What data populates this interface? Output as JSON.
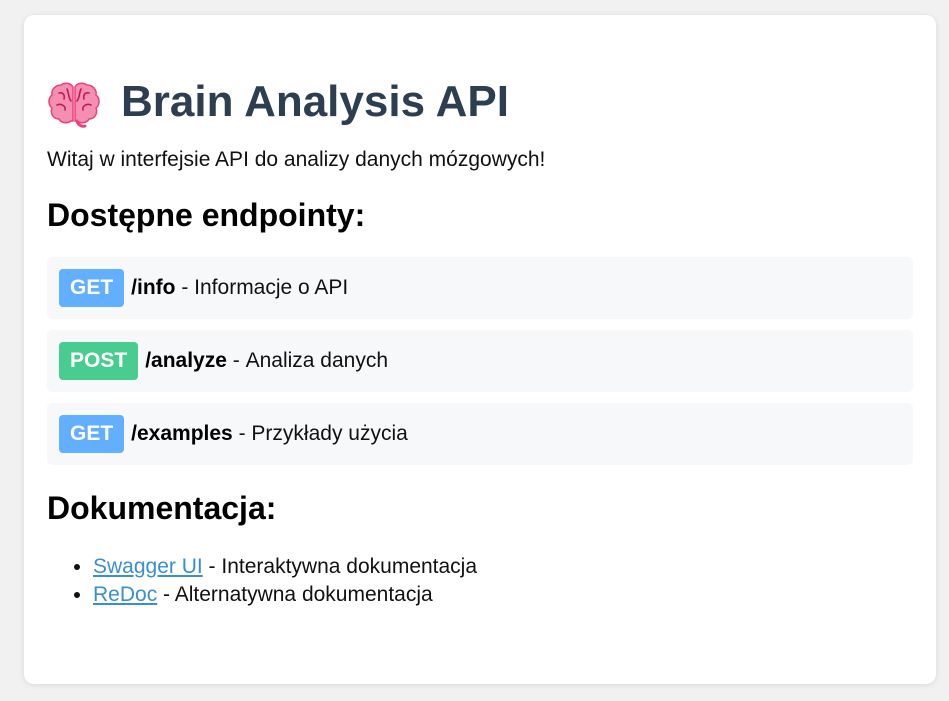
{
  "header": {
    "title": "Brain Analysis API",
    "icon": "brain-icon"
  },
  "intro": "Witaj w interfejsie API do analizy danych mózgowych!",
  "endpoints_section": {
    "heading": "Dostępne endpointy:",
    "items": [
      {
        "method": "GET",
        "path": "/info",
        "separator": " - ",
        "description": "Informacje o API"
      },
      {
        "method": "POST",
        "path": "/analyze",
        "separator": " - ",
        "description": "Analiza danych"
      },
      {
        "method": "GET",
        "path": "/examples",
        "separator": " - ",
        "description": "Przykłady użycia"
      }
    ]
  },
  "docs_section": {
    "heading": "Dokumentacja:",
    "items": [
      {
        "link": "Swagger UI",
        "separator": " - ",
        "description": "Interaktywna dokumentacja"
      },
      {
        "link": "ReDoc",
        "separator": " - ",
        "description": "Alternatywna dokumentacja"
      }
    ]
  },
  "colors": {
    "get": "#61affe",
    "post": "#49cc90",
    "title": "#2c3e50",
    "link": "#3a8fd1"
  }
}
